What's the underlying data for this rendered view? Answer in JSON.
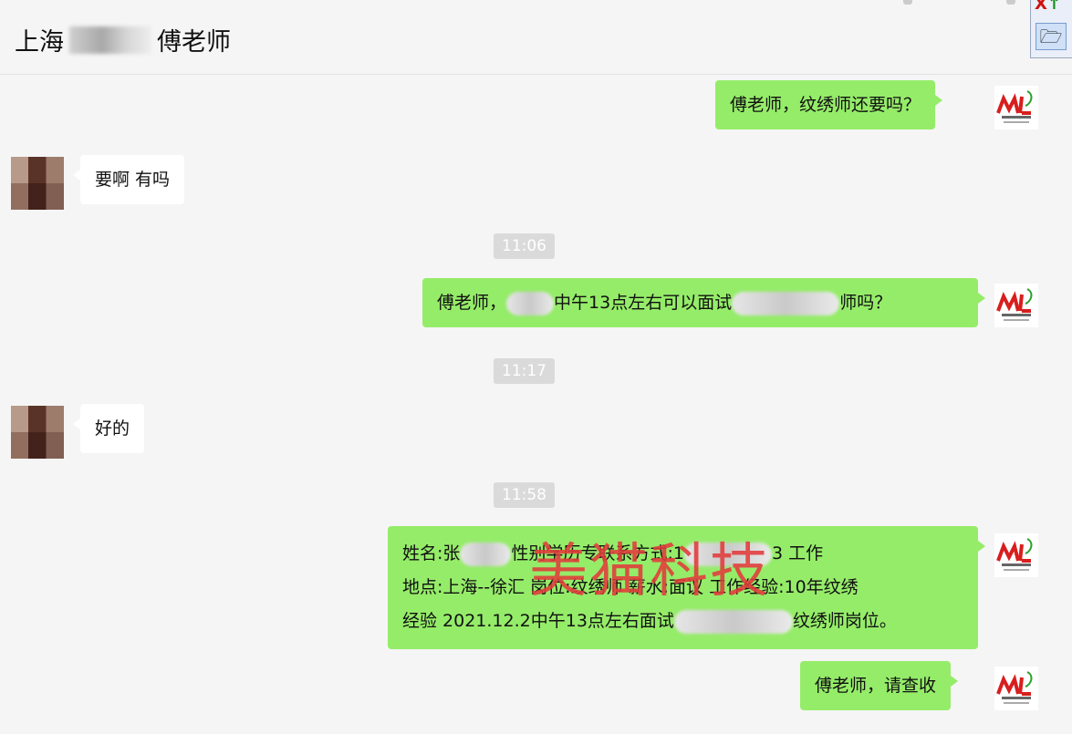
{
  "header": {
    "title_prefix": "上海",
    "title_suffix": "傅老师"
  },
  "toolbar": {
    "open_icon": "folder-open-icon"
  },
  "messages": [
    {
      "id": "m1",
      "side": "out",
      "text": "傅老师，纹绣师还要吗？"
    },
    {
      "id": "m2",
      "side": "in",
      "text": "要啊 有吗"
    },
    {
      "id": "t1",
      "type": "time",
      "text": "11:06"
    },
    {
      "id": "m3",
      "side": "out",
      "text_a": "傅老师，",
      "text_b": "中午13点左右可以面试",
      "text_c": "师吗？"
    },
    {
      "id": "t2",
      "type": "time",
      "text": "11:17"
    },
    {
      "id": "m4",
      "side": "in",
      "text": "好的"
    },
    {
      "id": "t3",
      "type": "time",
      "text": "11:58"
    },
    {
      "id": "m5",
      "side": "out",
      "line1_a": "姓名:张",
      "line1_b": "性别",
      "line1_c": "学历",
      "line1_d": "专",
      "line1_e": "联系方式:1",
      "line1_f": "3 工作",
      "line2_a": "地点:上海--徐汇",
      "line2_b": "岗位:纹绣师",
      "line2_c": "薪水:面议",
      "line2_d": "工作经验:10年纹绣",
      "line3_a": "经验 2021.12.2中午13点左右面试",
      "line3_b": "纹绣师岗位。"
    },
    {
      "id": "m6",
      "side": "out",
      "text": "傅老师，请查收"
    }
  ],
  "watermark": "美猫科技",
  "colors": {
    "outgoing_bubble": "#95ec69",
    "incoming_bubble": "#ffffff",
    "watermark": "#e33b3b",
    "time_badge": "#dadada"
  }
}
